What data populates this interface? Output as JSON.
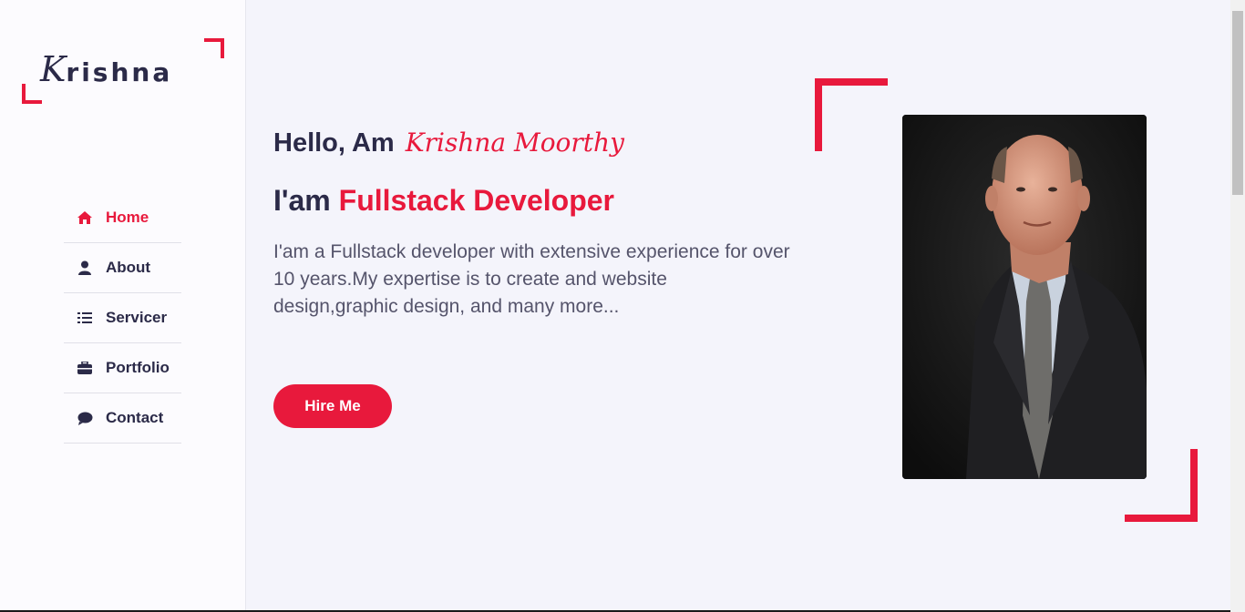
{
  "logo": {
    "initial": "K",
    "rest": "rishna"
  },
  "nav": {
    "items": [
      {
        "label": "Home",
        "icon": "home-icon",
        "active": true
      },
      {
        "label": "About",
        "icon": "user-icon",
        "active": false
      },
      {
        "label": "Servicer",
        "icon": "list-icon",
        "active": false
      },
      {
        "label": "Portfolio",
        "icon": "briefcase-icon",
        "active": false
      },
      {
        "label": "Contact",
        "icon": "comment-icon",
        "active": false
      }
    ]
  },
  "hero": {
    "greeting": "Hello, Am",
    "name": "Krishna Moorthy",
    "role_prefix": "I'am",
    "role": "Fullstack Developer",
    "description": "I'am a Fullstack developer with extensive experience for over 10 years.My expertise is to create and website design,graphic design, and many more...",
    "cta_label": "Hire Me"
  },
  "colors": {
    "accent": "#e8193c",
    "text": "#2b2a48",
    "muted": "#55546b",
    "background": "#f4f4fb"
  }
}
